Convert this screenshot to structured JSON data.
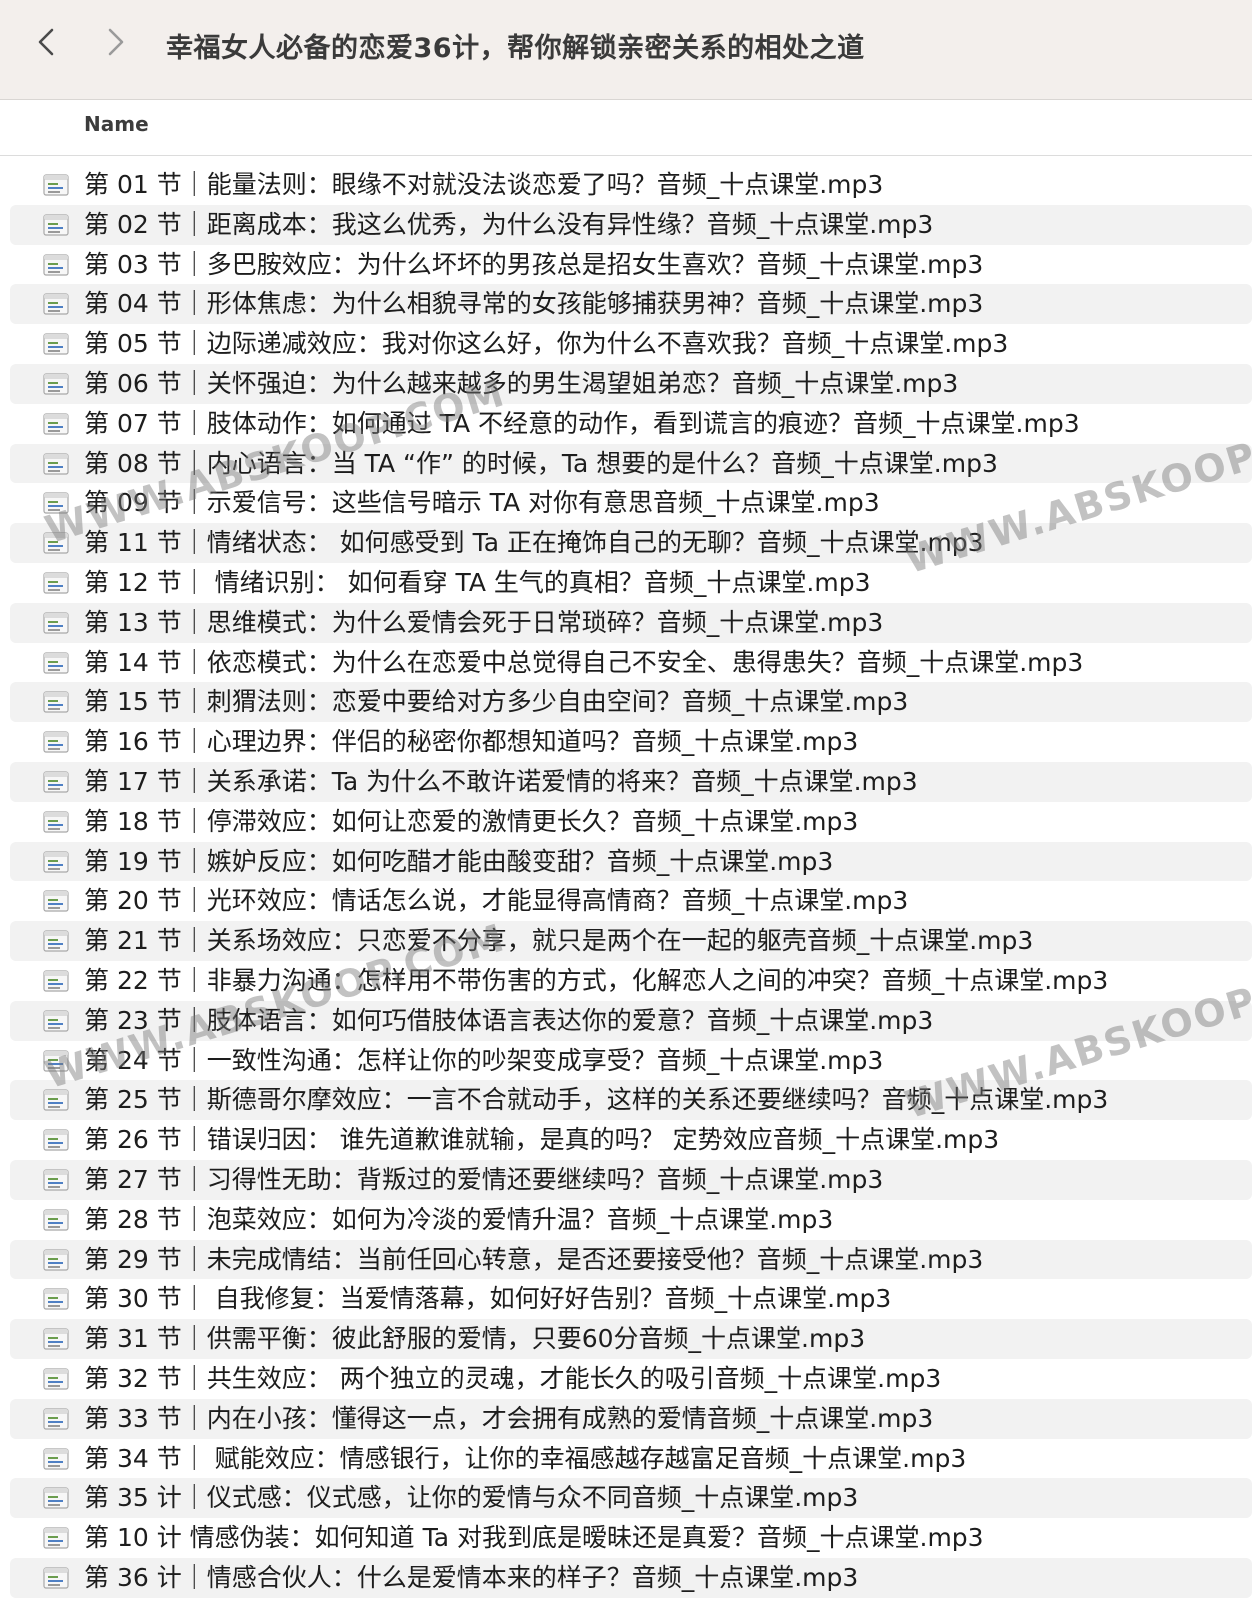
{
  "window": {
    "title": "幸福女人必备的恋爱36计，帮你解锁亲密关系的相处之道",
    "back_icon": "chevron-left-icon",
    "forward_icon": "chevron-right-icon"
  },
  "columns": {
    "name": "Name"
  },
  "file_icon": "audio-file-icon",
  "files": [
    "第 01 节｜能量法则：眼缘不对就没法谈恋爱了吗？音频_十点课堂.mp3",
    "第 02 节｜距离成本：我这么优秀，为什么没有异性缘？音频_十点课堂.mp3",
    "第 03 节｜多巴胺效应：为什么坏坏的男孩总是招女生喜欢？音频_十点课堂.mp3",
    "第 04 节｜形体焦虑：为什么相貌寻常的女孩能够捕获男神？音频_十点课堂.mp3",
    "第 05 节｜边际递减效应：我对你这么好，你为什么不喜欢我？音频_十点课堂.mp3",
    "第 06 节｜关怀强迫：为什么越来越多的男生渴望姐弟恋？音频_十点课堂.mp3",
    "第 07 节｜肢体动作：如何通过 TA 不经意的动作，看到谎言的痕迹？音频_十点课堂.mp3",
    "第 08 节｜内心语言：当 TA “作” 的时候，Ta 想要的是什么？音频_十点课堂.mp3",
    "第 09 节｜示爱信号：这些信号暗示 TA 对你有意思音频_十点课堂.mp3",
    "第 11 节｜情绪状态： 如何感受到 Ta 正在掩饰自己的无聊？音频_十点课堂.mp3",
    "第 12 节｜ 情绪识别： 如何看穿 TA 生气的真相？音频_十点课堂.mp3",
    "第 13 节｜思维模式：为什么爱情会死于日常琐碎？音频_十点课堂.mp3",
    "第 14 节｜依恋模式：为什么在恋爱中总觉得自己不安全、患得患失？音频_十点课堂.mp3",
    "第 15 节｜刺猬法则：恋爱中要给对方多少自由空间？音频_十点课堂.mp3",
    "第 16 节｜心理边界：伴侣的秘密你都想知道吗？音频_十点课堂.mp3",
    "第 17 节｜关系承诺：Ta 为什么不敢许诺爱情的将来？音频_十点课堂.mp3",
    "第 18 节｜停滞效应：如何让恋爱的激情更长久？音频_十点课堂.mp3",
    "第 19 节｜嫉妒反应：如何吃醋才能由酸变甜？音频_十点课堂.mp3",
    "第 20 节｜光环效应：情话怎么说，才能显得高情商？音频_十点课堂.mp3",
    "第 21 节｜关系场效应：只恋爱不分享，就只是两个在一起的躯壳音频_十点课堂.mp3",
    "第 22 节｜非暴力沟通：怎样用不带伤害的方式，化解恋人之间的冲突？音频_十点课堂.mp3",
    "第 23 节｜肢体语言：如何巧借肢体语言表达你的爱意？音频_十点课堂.mp3",
    "第 24 节｜一致性沟通：怎样让你的吵架变成享受？音频_十点课堂.mp3",
    "第 25 节｜斯德哥尔摩效应：一言不合就动手，这样的关系还要继续吗？音频_十点课堂.mp3",
    "第 26 节｜错误归因： 谁先道歉谁就输，是真的吗？ 定势效应音频_十点课堂.mp3",
    "第 27 节｜习得性无助：背叛过的爱情还要继续吗？音频_十点课堂.mp3",
    "第 28 节｜泡菜效应：如何为冷淡的爱情升温？音频_十点课堂.mp3",
    "第 29 节｜未完成情结：当前任回心转意，是否还要接受他？音频_十点课堂.mp3",
    "第 30 节｜ 自我修复：当爱情落幕，如何好好告别？音频_十点课堂.mp3",
    "第 31 节｜供需平衡：彼此舒服的爱情，只要60分音频_十点课堂.mp3",
    "第 32 节｜共生效应： 两个独立的灵魂，才能长久的吸引音频_十点课堂.mp3",
    "第 33 节｜内在小孩：懂得这一点，才会拥有成熟的爱情音频_十点课堂.mp3",
    "第 34 节｜ 赋能效应：情感银行，让你的幸福感越存越富足音频_十点课堂.mp3",
    "第 35 计｜仪式感：仪式感，让你的爱情与众不同音频_十点课堂.mp3",
    "第 10 计  情感伪装：如何知道 Ta 对我到底是暧昧还是真爱？音频_十点课堂.mp3",
    "第 36 计｜情感合伙人：什么是爱情本来的样子？音频_十点课堂.mp3"
  ],
  "watermark": "WWW.ABSKOOP.COM"
}
